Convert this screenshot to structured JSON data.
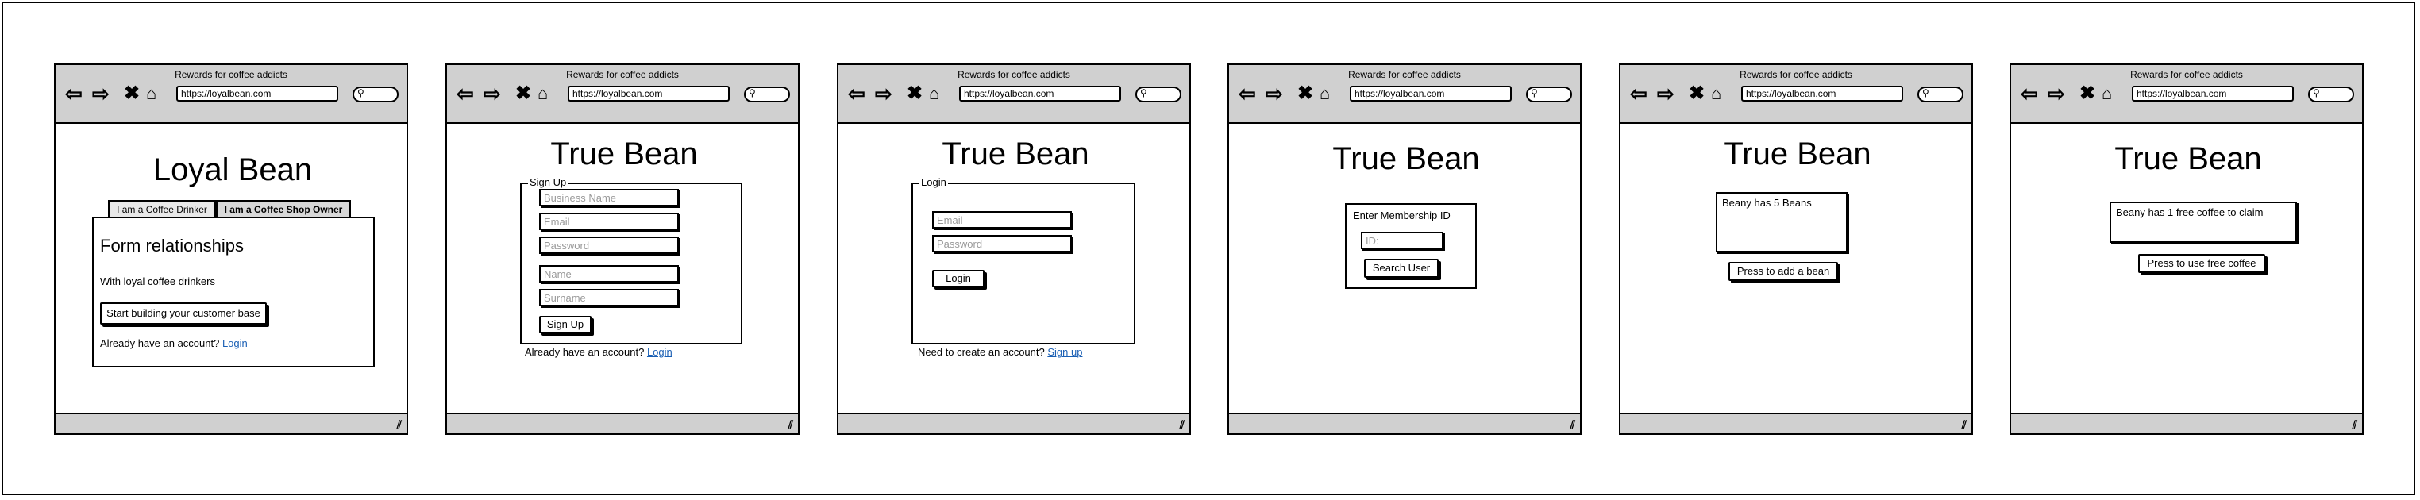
{
  "browser": {
    "title": "Rewards for coffee addicts",
    "url": "https://loyalbean.com",
    "icons": [
      "back-arrow-icon",
      "forward-arrow-icon",
      "stop-icon",
      "home-icon",
      "search-icon",
      "resize-grip-icon"
    ]
  },
  "screen1": {
    "title": "Loyal Bean",
    "tabs": [
      "I am a Coffee Drinker",
      "I am a Coffee Shop Owner"
    ],
    "heading": "Form relationships",
    "subtext": "With loyal coffee drinkers",
    "cta_label": "Start building your customer base",
    "account_prompt": "Already have an account?",
    "login_link": "Login"
  },
  "screen2": {
    "title": "True Bean",
    "legend": "Sign Up",
    "placeholders": {
      "business_name": "Business Name",
      "email": "Email",
      "password": "Password",
      "name": "Name",
      "surname": "Surname"
    },
    "submit_label": "Sign Up",
    "account_prompt": "Already have an account?",
    "login_link": "Login"
  },
  "screen3": {
    "title": "True Bean",
    "legend": "Login",
    "placeholders": {
      "email": "Email",
      "password": "Password"
    },
    "submit_label": "Login",
    "account_prompt": "Need to create an account?",
    "signup_link": "Sign up"
  },
  "screen4": {
    "title": "True Bean",
    "prompt": "Enter Membership ID",
    "id_placeholder": "ID:",
    "button_label": "Search User"
  },
  "screen5": {
    "title": "True Bean",
    "message": "Beany has 5 Beans",
    "button_label": "Press to add a bean"
  },
  "screen6": {
    "title": "True Bean",
    "message": "Beany has 1 free coffee to claim",
    "button_label": "Press to use free coffee"
  }
}
